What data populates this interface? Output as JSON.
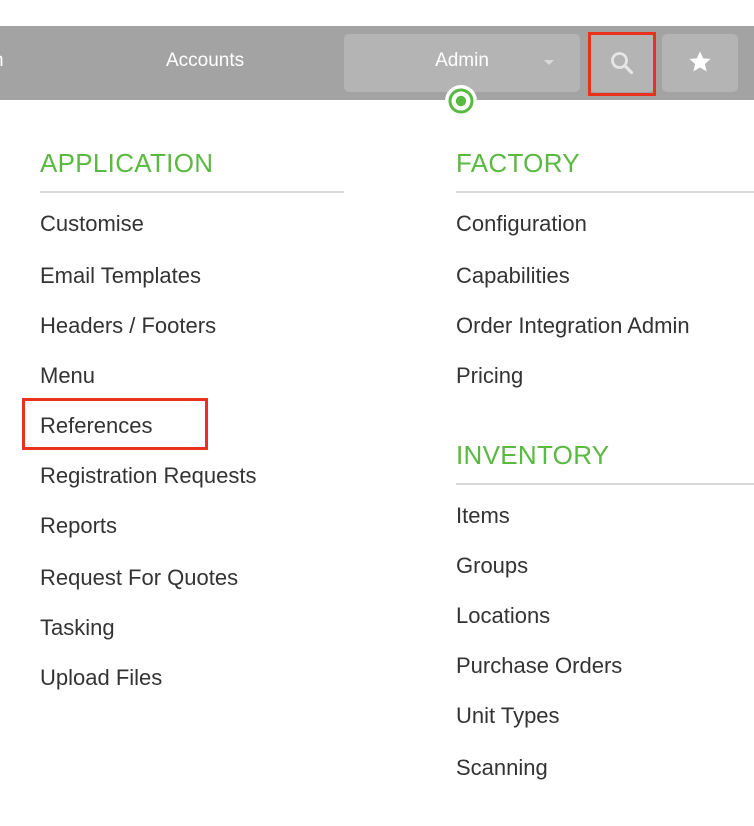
{
  "navbar": {
    "partial_label": "n",
    "accounts_label": "Accounts",
    "admin_label": "Admin",
    "search_icon": "search-icon",
    "favorites_icon": "star-icon",
    "bar_color": "#a3a3a3",
    "button_color": "#b4b4b4",
    "indicator_color": "#5ab940"
  },
  "menu": {
    "accent_color": "#5ab940",
    "application": {
      "title": "APPLICATION",
      "items": [
        "Customise",
        "Email Templates",
        "Headers / Footers",
        "Menu",
        "References",
        "Registration Requests",
        "Reports",
        "Request For Quotes",
        "Tasking",
        "Upload Files"
      ]
    },
    "factory": {
      "title": "FACTORY",
      "items": [
        "Configuration",
        "Capabilities",
        "Order Integration Admin",
        "Pricing"
      ]
    },
    "inventory": {
      "title": "INVENTORY",
      "items": [
        "Items",
        "Groups",
        "Locations",
        "Purchase Orders",
        "Unit Types",
        "Scanning"
      ]
    }
  },
  "highlight_color": "#e8321e"
}
